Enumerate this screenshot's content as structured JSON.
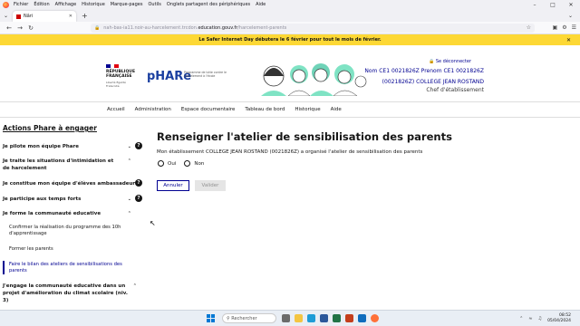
{
  "browser": {
    "menu_items": [
      "Fichier",
      "Édition",
      "Affichage",
      "Historique",
      "Marque-pages",
      "Outils",
      "Onglets partagent des périphériques",
      "Aide"
    ],
    "tab_title": "Nâri",
    "url_prefix": "nah-bas-ia11.noir-au-harcelement.trcdon.",
    "url_domain": "education.gouv.fr",
    "url_path": "/harcelement-parents"
  },
  "banner": {
    "text": "Le Safer Internet Day débutera le 6 février pour tout le mois de février."
  },
  "header": {
    "republique_line1": "RÉPUBLIQUE",
    "republique_line2": "FRANÇAISE",
    "devise": "Liberté Égalité Fraternité",
    "app_name": "pHARe",
    "app_tagline": "Programme de lutte contre le harcèlement à l'école",
    "logout": "Se déconnecter",
    "user_name": "Nom CE1 0021826Z Prenom CE1 0021826Z",
    "establishment": "(0021826Z) COLLEGE JEAN ROSTAND",
    "role": "Chef d'établissement"
  },
  "nav": [
    "Accueil",
    "Administration",
    "Espace documentaire",
    "Tableau de bord",
    "Historique",
    "Aide"
  ],
  "sidebar": {
    "title": "Actions Phare à engager",
    "items": [
      "Je pilote mon équipe Phare",
      "Je traite les situations d'intimidation et de harcelement",
      "Je constitue mon équipe d'élèves ambassadeurs",
      "Je participe aux temps forts",
      "Je forme la communauté educative",
      "J'engage la communauté educative dans un projet d'amélioration du climat scolaire (niv. 3)"
    ],
    "sub_items": [
      "Confirmer la réalisation du programme des 10h d'apprentissage",
      "Former les parents",
      "Faire le bilan des ateliers de sensibilisations des parents"
    ]
  },
  "content": {
    "title": "Renseigner l'atelier de sensibilisation des parents",
    "description": "Mon établissement COLLEGE JEAN ROSTAND (0021826Z) a organisé l'atelier de sensibilisation des parents",
    "option_yes": "Oui",
    "option_no": "Non",
    "cancel": "Annuler",
    "validate": "Valider"
  },
  "taskbar": {
    "search_placeholder": "Rechercher",
    "time": "08:52",
    "date": "05/04/2024"
  },
  "colors": {
    "primary": "#000091",
    "banner": "#fdd835"
  }
}
